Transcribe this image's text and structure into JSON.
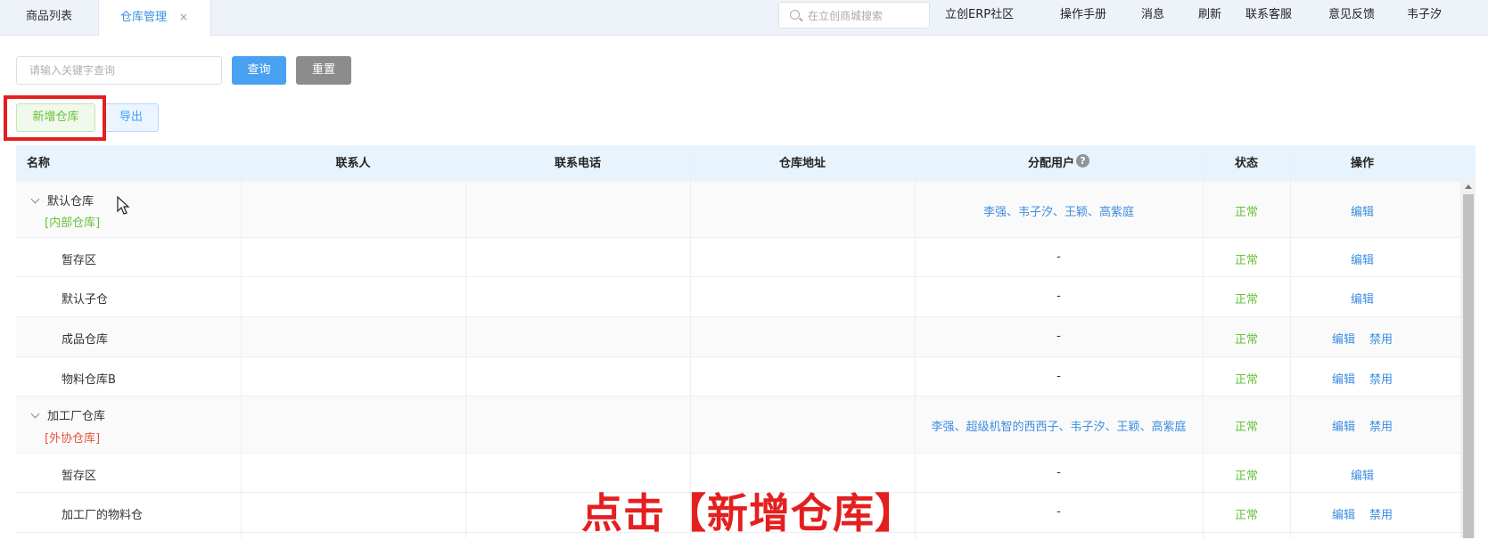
{
  "tabs": [
    {
      "label": "商品列表"
    },
    {
      "label": "仓库管理",
      "close": "×"
    }
  ],
  "top_search": {
    "placeholder": "在立创商城搜索"
  },
  "nav": [
    "立创ERP社区",
    "操作手册",
    "消息",
    "刷新",
    "联系客服",
    "意见反馈",
    "韦子汐"
  ],
  "filter": {
    "keyword_placeholder": "请输入关键字查询",
    "query_label": "查询",
    "reset_label": "重置"
  },
  "actions": {
    "add_label": "新增仓库",
    "export_label": "导出"
  },
  "table": {
    "headers": [
      "名称",
      "联系人",
      "联系电话",
      "仓库地址",
      "分配用户",
      "状态",
      "操作"
    ],
    "help_mark": "?",
    "rows": [
      {
        "name": "默认仓库",
        "tag": "[内部仓库]",
        "users": "李强、韦子汐、王颖、高紫庭",
        "status": "正常",
        "op1": "编辑",
        "op2": ""
      },
      {
        "name": "暂存区",
        "tag": "",
        "users": "-",
        "status": "正常",
        "op1": "编辑",
        "op2": ""
      },
      {
        "name": "默认子仓",
        "tag": "",
        "users": "-",
        "status": "正常",
        "op1": "编辑",
        "op2": ""
      },
      {
        "name": "成品仓库",
        "tag": "",
        "users": "-",
        "status": "正常",
        "op1": "编辑",
        "op2": "禁用"
      },
      {
        "name": "物料仓库B",
        "tag": "",
        "users": "-",
        "status": "正常",
        "op1": "编辑",
        "op2": "禁用"
      },
      {
        "name": "加工厂仓库",
        "tag": "[外协仓库]",
        "users": "李强、超级机智的西西子、韦子汐、王颖、高紫庭",
        "status": "正常",
        "op1": "编辑",
        "op2": "禁用"
      },
      {
        "name": "暂存区",
        "tag": "",
        "users": "-",
        "status": "正常",
        "op1": "编辑",
        "op2": ""
      },
      {
        "name": "加工厂的物料仓",
        "tag": "",
        "users": "-",
        "status": "正常",
        "op1": "编辑",
        "op2": "禁用"
      }
    ]
  },
  "overlay_text": "点击【新增仓库】",
  "colors": {
    "accent": "#409eff",
    "success": "#67c23a",
    "danger": "#e41f1f",
    "external": "#e6543b"
  }
}
